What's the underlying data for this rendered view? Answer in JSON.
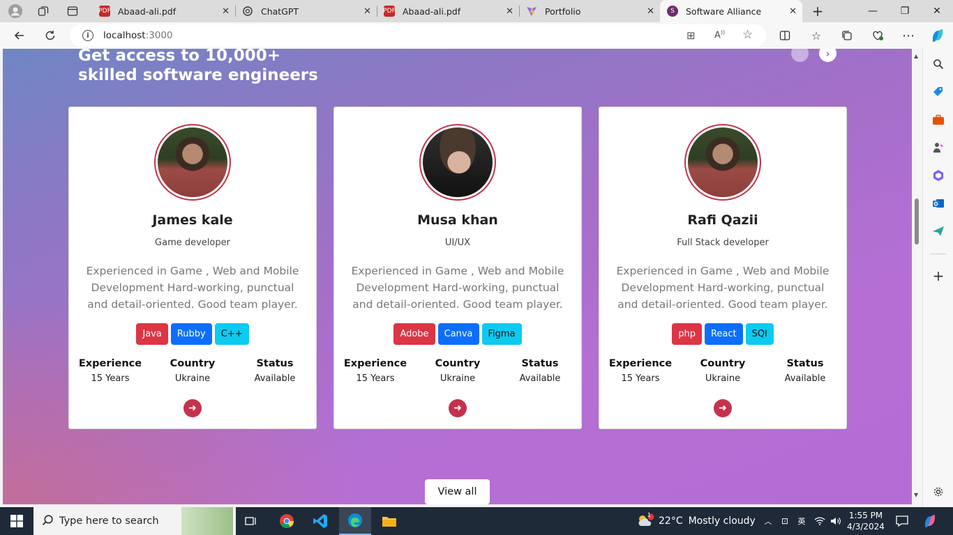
{
  "browser": {
    "tabs": [
      {
        "title": "Abaad-ali.pdf",
        "icon": "pdf-icon"
      },
      {
        "title": "ChatGPT",
        "icon": "chatgpt-icon"
      },
      {
        "title": "Abaad-ali.pdf",
        "icon": "pdf-icon"
      },
      {
        "title": "Portfolio",
        "icon": "vite-icon"
      },
      {
        "title": "Software Alliance",
        "icon": "site-icon",
        "active": true
      }
    ],
    "url_host": "localhost",
    "url_port": ":3000"
  },
  "page": {
    "heading_line1": "Get access to 10,000+",
    "heading_line2": "skilled software engineers",
    "view_all": "View all",
    "accent_color": "#c4324d",
    "cards": [
      {
        "name": "James kale",
        "role": "Game developer",
        "description": "Experienced in Game , Web and Mobile Development Hard-working, punctual and detail-oriented. Good team player.",
        "skills": [
          {
            "label": "Java",
            "color": "#dc3545"
          },
          {
            "label": "Rubby",
            "color": "#0d6efd"
          },
          {
            "label": "C++",
            "color": "#0dcaf0"
          }
        ],
        "stats": [
          {
            "label": "Experience",
            "value": "15 Years"
          },
          {
            "label": "Country",
            "value": "Ukraine"
          },
          {
            "label": "Status",
            "value": "Available"
          }
        ]
      },
      {
        "name": "Musa khan",
        "role": "UI/UX",
        "description": "Experienced in Game , Web and Mobile Development Hard-working, punctual and detail-oriented. Good team player.",
        "skills": [
          {
            "label": "Adobe",
            "color": "#dc3545"
          },
          {
            "label": "Canva",
            "color": "#0d6efd"
          },
          {
            "label": "Figma",
            "color": "#0dcaf0"
          }
        ],
        "stats": [
          {
            "label": "Experience",
            "value": "15 Years"
          },
          {
            "label": "Country",
            "value": "Ukraine"
          },
          {
            "label": "Status",
            "value": "Available"
          }
        ]
      },
      {
        "name": "Rafi Qazii",
        "role": "Full Stack developer",
        "description": "Experienced in Game , Web and Mobile Development Hard-working, punctual and detail-oriented. Good team player.",
        "skills": [
          {
            "label": "php",
            "color": "#dc3545"
          },
          {
            "label": "React",
            "color": "#0d6efd"
          },
          {
            "label": "SQl",
            "color": "#0dcaf0"
          }
        ],
        "stats": [
          {
            "label": "Experience",
            "value": "15 Years"
          },
          {
            "label": "Country",
            "value": "Ukraine"
          },
          {
            "label": "Status",
            "value": "Available"
          }
        ]
      }
    ]
  },
  "taskbar": {
    "search_placeholder": "Type here to search",
    "weather_temp": "22°C",
    "weather_text": "Mostly cloudy",
    "weather_badge": "1",
    "time": "1:55 PM",
    "date": "4/3/2024"
  }
}
